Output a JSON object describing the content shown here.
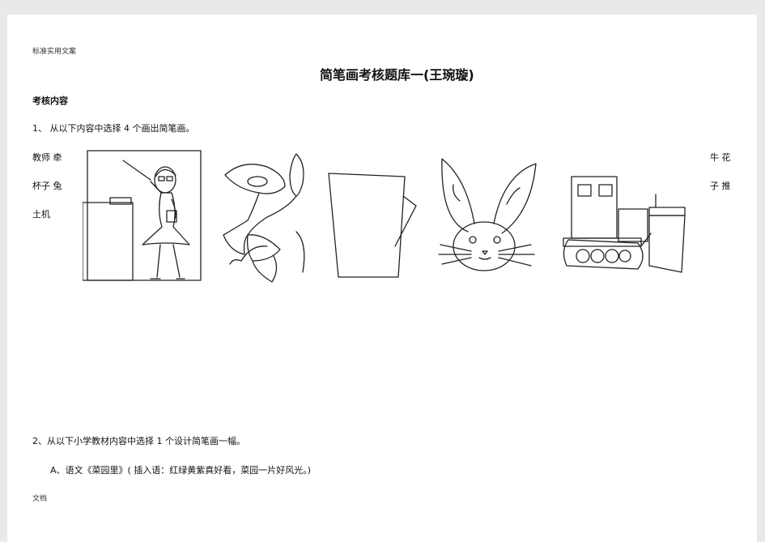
{
  "header": "标准实用文案",
  "title": "简笔画考核题库一(王琬璇)",
  "section": "考核内容",
  "question1": {
    "text": "1、 从以下内容中选择 4 个画出简笔画。",
    "left_lines": [
      "教师 牵",
      "杯子 兔",
      "土机"
    ],
    "right_lines": [
      "牛  花",
      "子  推"
    ]
  },
  "drawings": [
    "teacher",
    "morning-glory",
    "cup",
    "rabbit",
    "bulldozer"
  ],
  "question2": {
    "text": "2、从以下小学教材内容中选择 1 个设计简笔画一幅。",
    "option_a": "A、语文《菜园里》( 插入语：红绿黄紫真好看，菜园一片好风光。)"
  },
  "footer": "文档"
}
